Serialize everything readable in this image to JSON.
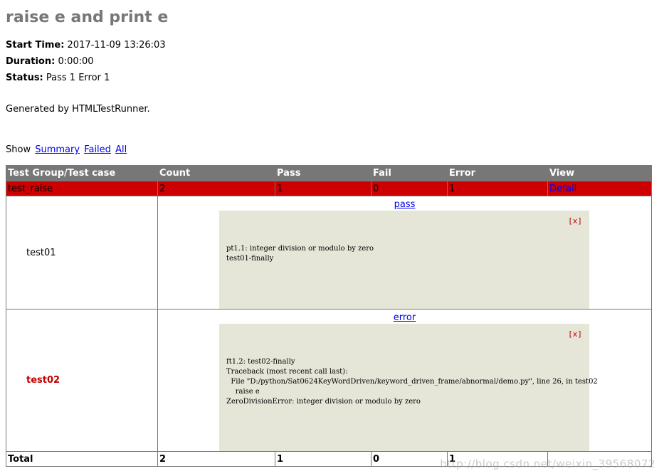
{
  "heading": {
    "title": "raise e and print e",
    "start_time_label": "Start Time:",
    "start_time_value": "2017-11-09 13:26:03",
    "duration_label": "Duration:",
    "duration_value": "0:00:00",
    "status_label": "Status:",
    "status_value": "Pass 1 Error 1",
    "generated": "Generated by HTMLTestRunner."
  },
  "show_bar": {
    "label": "Show",
    "summary": "Summary",
    "failed": "Failed",
    "all": "All"
  },
  "table": {
    "headers": [
      "Test Group/Test case",
      "Count",
      "Pass",
      "Fail",
      "Error",
      "View"
    ],
    "class_row": {
      "name": "test_raise",
      "count": "2",
      "pass": "1",
      "fail": "0",
      "error": "1",
      "view": "Detail"
    },
    "cases": [
      {
        "name": "test01",
        "status": "pass",
        "close": "[x]",
        "output": "pt1.1: integer division or modulo by zero\ntest01-finally"
      },
      {
        "name": "test02",
        "status": "error",
        "close": "[x]",
        "output": "ft1.2: test02-finally\nTraceback (most recent call last):\n  File \"D:/python/Sat0624KeyWordDriven/keyword_driven_frame/abnormal/demo.py\", line 26, in test02\n    raise e\nZeroDivisionError: integer division or modulo by zero"
      }
    ],
    "total": {
      "label": "Total",
      "count": "2",
      "pass": "1",
      "fail": "0",
      "error": "1"
    }
  },
  "watermark": "http://blog.csdn.net/weixin_39568072",
  "colors": {
    "header_bg": "#777777",
    "error_row_bg": "#cc0000",
    "popup_bg": "#e5e5d8",
    "title_color": "#777777"
  }
}
